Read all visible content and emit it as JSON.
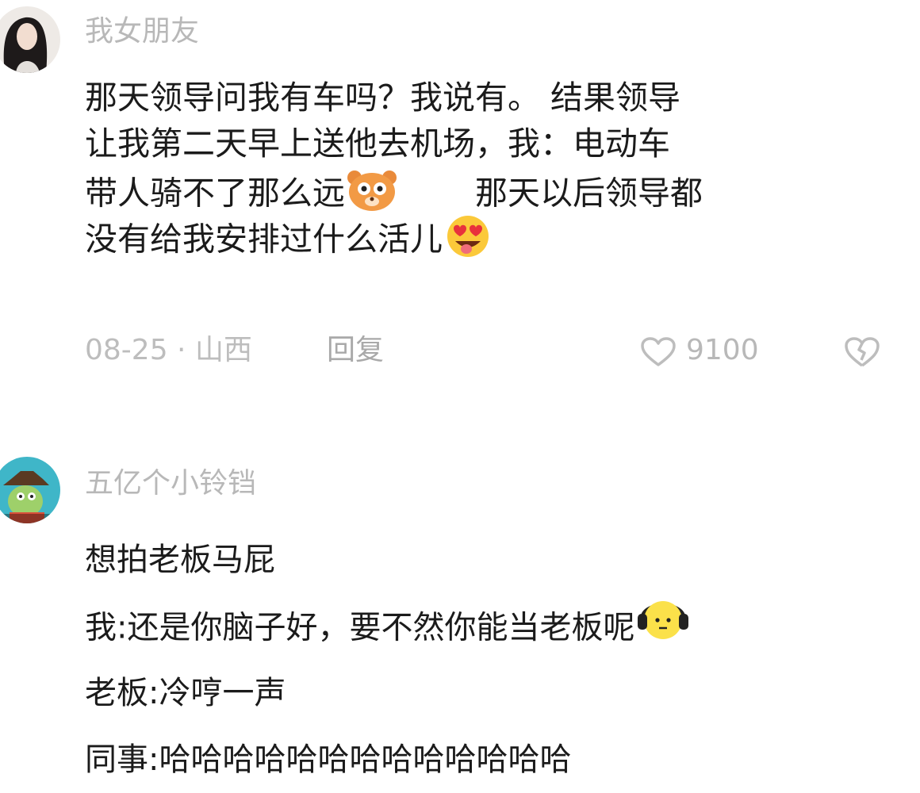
{
  "comments": [
    {
      "username": "我女朋友",
      "avatar": "portrait-avatar-icon",
      "lines": [
        {
          "a": "那天领导问我有车吗？我说有。  结果领导",
          "emoji": null,
          "b": ""
        },
        {
          "a": "让我第二天早上送他去机场，我：电动车",
          "emoji": null,
          "b": ""
        },
        {
          "a": "带人骑不了那么远",
          "emoji": "bear-face-icon",
          "b": "那天以后领导都"
        },
        {
          "a": "没有给我安排过什么活儿",
          "emoji": "heart-eyes-tongue-icon",
          "b": ""
        }
      ],
      "date": "08-25 · 山西",
      "reply_label": "回复",
      "like_count": "9100"
    },
    {
      "username": "五亿个小铃铛",
      "avatar": "cartoon-avatar-icon",
      "lines": [
        {
          "a": "想拍老板马屁",
          "emoji": null
        },
        {
          "a": "我:还是你脑子好，要不然你能当老板呢",
          "emoji": "headphones-face-icon"
        },
        {
          "a": "老板:冷哼一声",
          "emoji": null
        },
        {
          "a": "同事:哈哈哈哈哈哈哈哈哈哈哈哈哈",
          "emoji": null
        }
      ]
    }
  ],
  "colors": {
    "text": "#1b1b1b",
    "muted": "#b8b8b8"
  }
}
